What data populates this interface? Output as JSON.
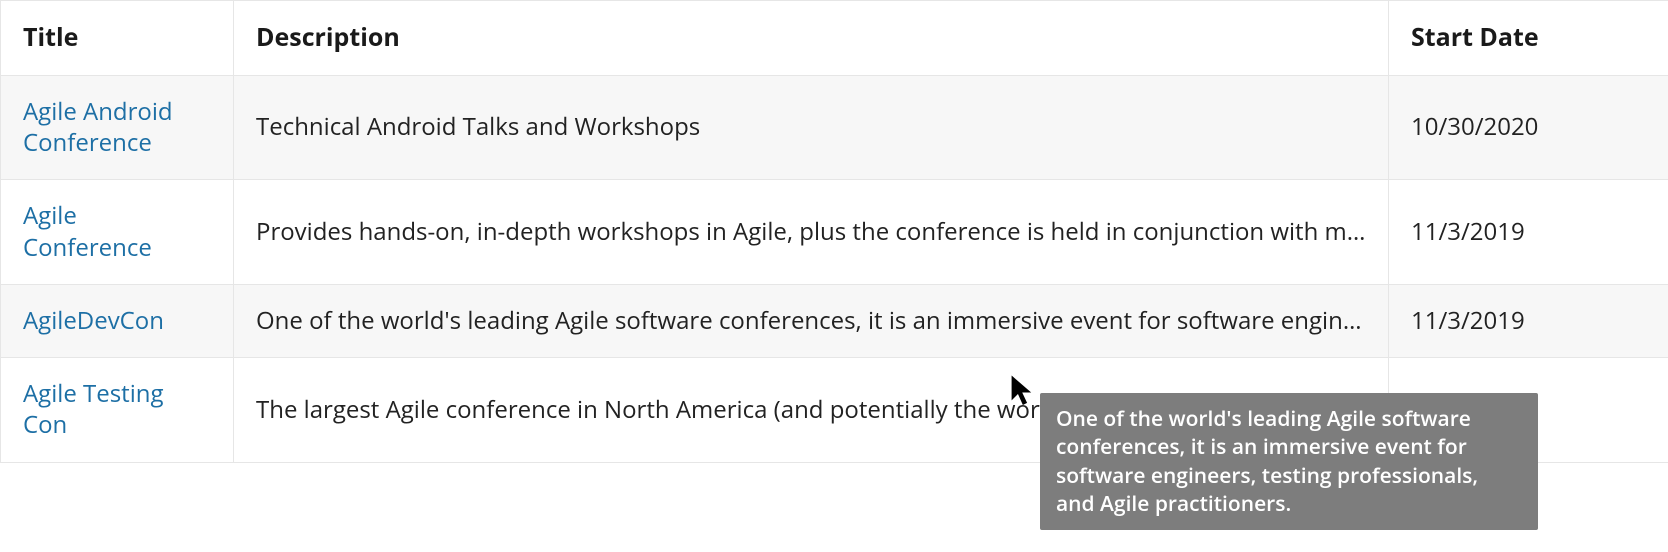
{
  "columns": {
    "title": "Title",
    "description": "Description",
    "start_date": "Start Date"
  },
  "rows": [
    {
      "title": "Agile Android Conference",
      "description": "Technical Android Talks and Workshops",
      "start_date": "10/30/2020"
    },
    {
      "title": "Agile Conference",
      "description": "Provides hands-on, in-depth workshops in Agile, plus the conference is held in conjunction with multiple other events to extend the value further.",
      "start_date": "11/3/2019"
    },
    {
      "title": "AgileDevCon",
      "description": "One of the world's leading Agile software conferences, it is an immersive event for software engineers, testing professionals, and Agile practitioners.",
      "start_date": "11/3/2019"
    },
    {
      "title": "Agile Testing Con",
      "description": "The largest Agile conference in North America (and potentially the world), it covers all aspects of Agile methodology.",
      "start_date": ""
    }
  ],
  "tooltip": {
    "text": "One of the world's leading Agile software conferences, it is an immersive event for software engineers, testing professionals, and Agile practitioners."
  }
}
